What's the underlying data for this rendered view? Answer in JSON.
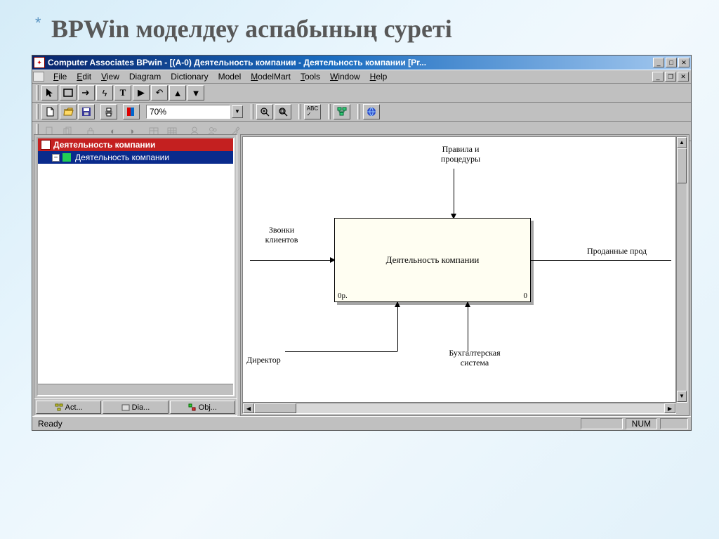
{
  "slide": {
    "asterisk": "*",
    "title": "BPWin  моделдеу аспабының суреті"
  },
  "window": {
    "title": "Computer Associates BPwin - [(A-0) Деятельность компании - Деятельность компании  [Pr..."
  },
  "menus": {
    "file": "File",
    "edit": "Edit",
    "view": "View",
    "diagram": "Diagram",
    "dictionary": "Dictionary",
    "model": "Model",
    "modelmart": "ModelMart",
    "tools": "Tools",
    "window": "Window",
    "help": "Help"
  },
  "zoom": {
    "value": "70%"
  },
  "tree": {
    "root": "Деятельность компании",
    "child": "Деятельность компании"
  },
  "tabs": {
    "act": "Act...",
    "dia": "Dia...",
    "obj": "Obj..."
  },
  "diagram": {
    "top_label": "Правила и\nпроцедуры",
    "left_label": "Звонки\nклиентов",
    "right_label": "Проданные прод",
    "bottom_left": "Директор",
    "bottom_right": "Бухгалтерская\nсистема",
    "box_label": "Деятельность компании",
    "corner_l": "0р.",
    "corner_r": "0"
  },
  "status": {
    "ready": "Ready",
    "num": "NUM"
  }
}
